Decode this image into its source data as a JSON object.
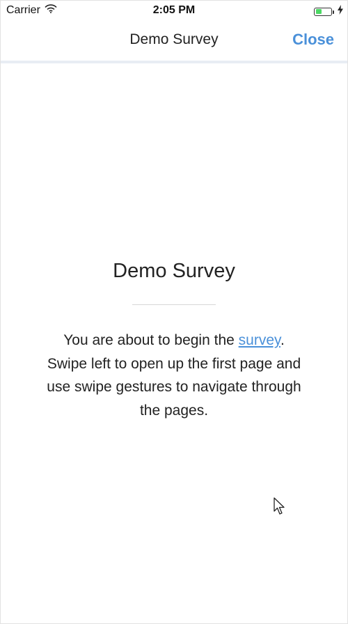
{
  "status_bar": {
    "carrier": "Carrier",
    "time": "2:05 PM",
    "wifi_icon": "wifi-icon",
    "battery_icon": "battery-icon",
    "battery_level": 0.4,
    "charging_icon": "charging-bolt-icon",
    "battery_color": "#4cd964"
  },
  "nav": {
    "title": "Demo Survey",
    "close_label": "Close",
    "accent_color": "#4a90d9"
  },
  "content": {
    "title": "Demo Survey",
    "intro_before_link": "You are about to begin the ",
    "intro_link": "survey",
    "intro_after_link": ". Swipe left to open up the first page and use swipe gestures to navigate through the pages."
  }
}
